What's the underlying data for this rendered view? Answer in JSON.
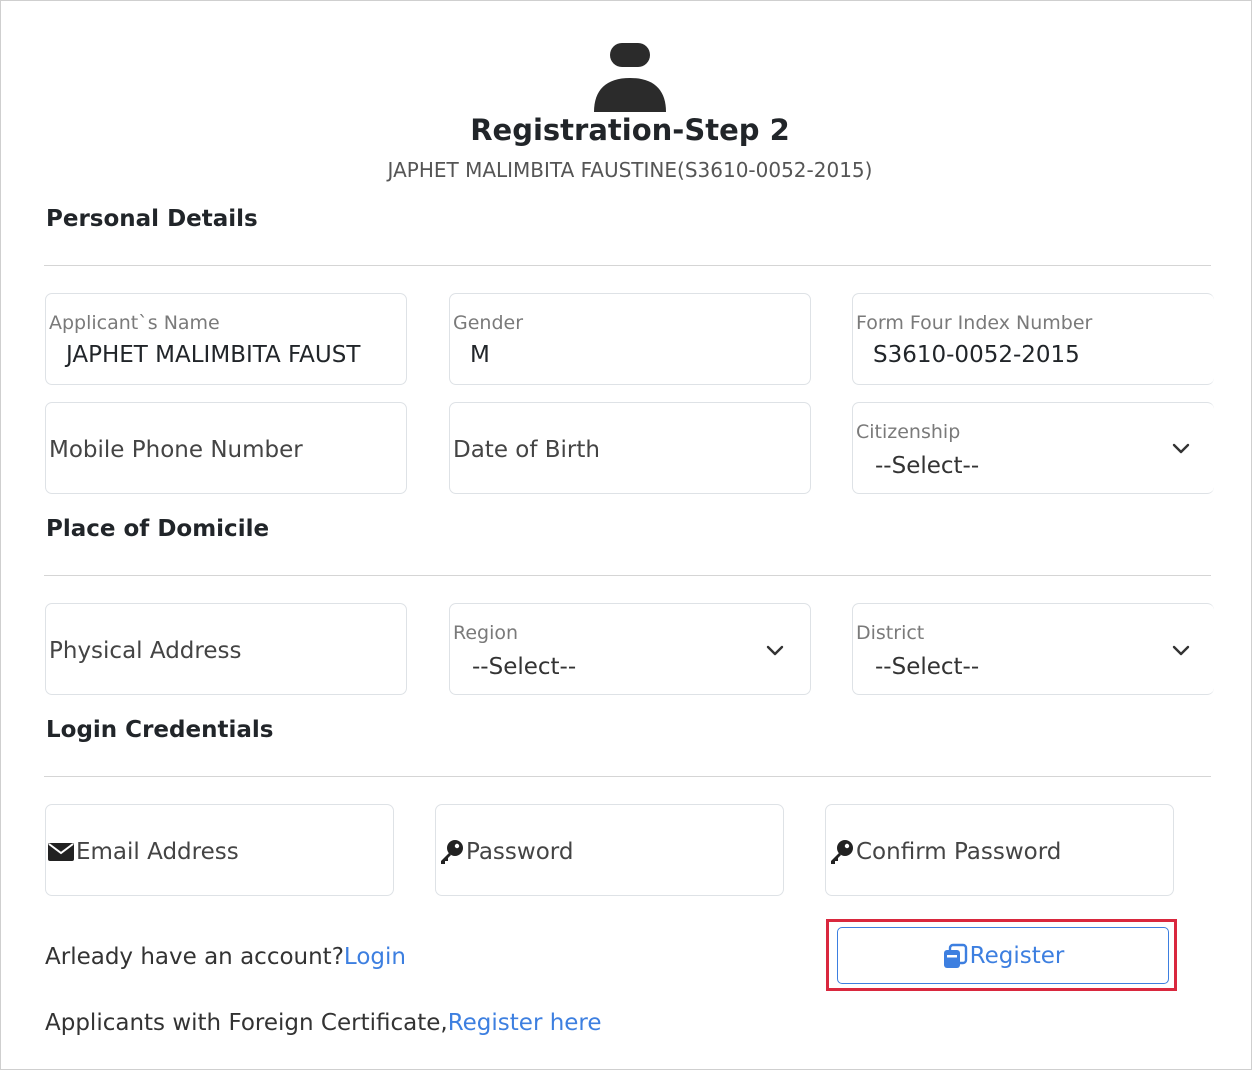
{
  "header": {
    "title": "Registration-Step 2",
    "subtitle": "JAPHET MALIMBITA FAUSTINE(S3610-0052-2015)"
  },
  "sections": {
    "personal": "Personal Details",
    "domicile": "Place of Domicile",
    "login": "Login Credentials"
  },
  "personal": {
    "name_label": "Applicant`s Name",
    "name_value": "JAPHET MALIMBITA FAUST",
    "gender_label": "Gender",
    "gender_value": "M",
    "index_label": "Form Four Index Number",
    "index_value": "S3610-0052-2015",
    "phone_placeholder": "Mobile Phone Number",
    "dob_placeholder": "Date of Birth",
    "citizenship_label": "Citizenship",
    "citizenship_value": "--Select--"
  },
  "domicile": {
    "address_placeholder": "Physical Address",
    "region_label": "Region",
    "region_value": "--Select--",
    "district_label": "District",
    "district_value": "--Select--"
  },
  "login": {
    "email_placeholder": "Email Address",
    "password_placeholder": "Password",
    "confirm_placeholder": "Confirm Password"
  },
  "footer": {
    "account_text": "Arleady have an account?",
    "login_link": "Login",
    "register_button": "Register",
    "foreign_text": "Applicants with Foreign Certificate,",
    "foreign_link": "Register here"
  },
  "colors": {
    "link": "#3d7fe0",
    "highlight": "#d9283e",
    "text": "#212529"
  },
  "icons": [
    "user-icon",
    "chevron-down-icon",
    "envelope-icon",
    "key-icon",
    "register-icon"
  ]
}
